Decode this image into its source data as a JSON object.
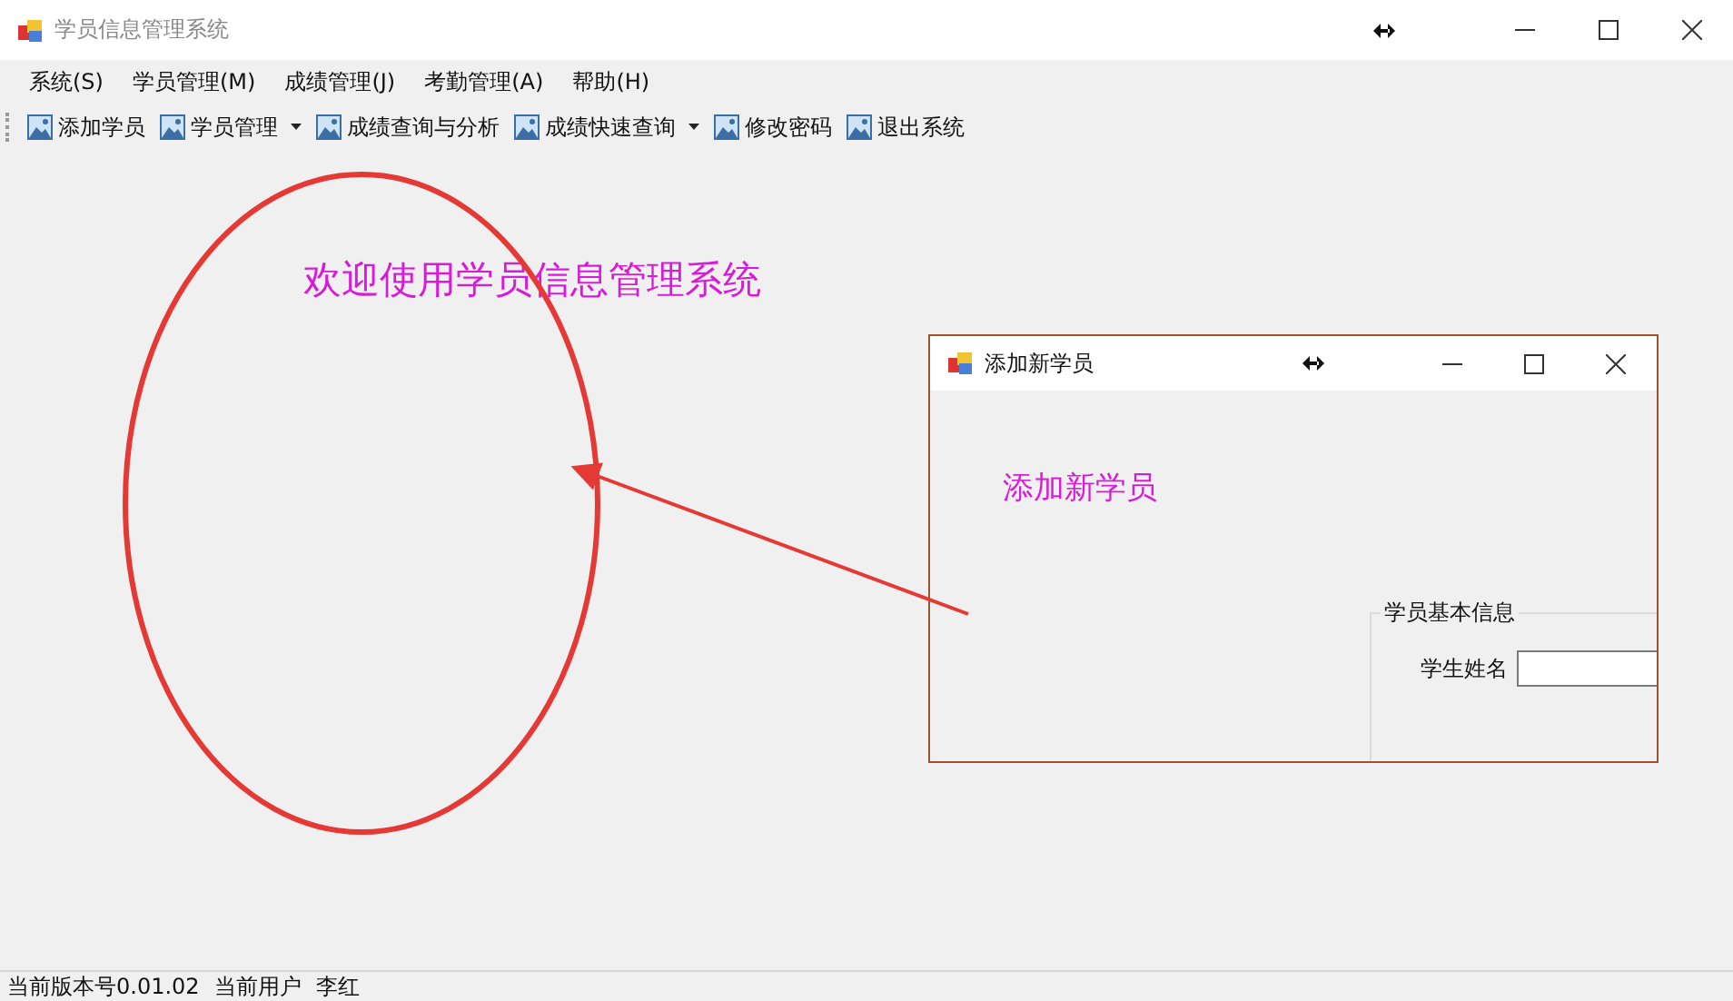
{
  "window": {
    "title": "学员信息管理系统"
  },
  "menu": [
    {
      "label": "系统(S)"
    },
    {
      "label": "学员管理(M)"
    },
    {
      "label": "成绩管理(J)"
    },
    {
      "label": "考勤管理(A)"
    },
    {
      "label": "帮助(H)"
    }
  ],
  "toolbar": [
    {
      "label": "添加学员",
      "kind": "button"
    },
    {
      "label": "学员管理",
      "kind": "dropdown"
    },
    {
      "label": "成绩查询与分析",
      "kind": "button"
    },
    {
      "label": "成绩快速查询",
      "kind": "dropdown"
    },
    {
      "label": "修改密码",
      "kind": "button"
    },
    {
      "label": "退出系统",
      "kind": "button"
    }
  ],
  "welcome": "欢迎使用学员信息管理系统",
  "child_window": {
    "title": "添加新学员",
    "heading": "添加新学员",
    "group_title": "学员基本信息",
    "fields": [
      {
        "label": "学生姓名"
      }
    ]
  },
  "status_bar": [
    "当前版本号0.01.02",
    "当前用户",
    "李红"
  ]
}
